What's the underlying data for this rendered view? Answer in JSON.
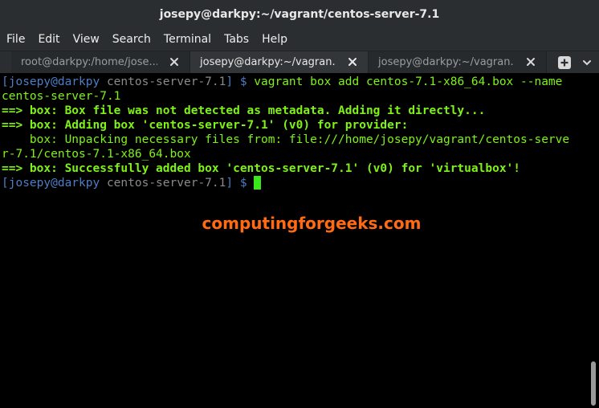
{
  "window": {
    "title": "josepy@darkpy:~/vagrant/centos-server-7.1"
  },
  "menubar": {
    "items": [
      "File",
      "Edit",
      "View",
      "Search",
      "Terminal",
      "Tabs",
      "Help"
    ]
  },
  "tabs": [
    {
      "label": "root@darkpy:/home/jose...",
      "active": false
    },
    {
      "label": "josepy@darkpy:~/vagran...",
      "active": true
    },
    {
      "label": "josepy@darkpy:~/vagran...",
      "active": false
    }
  ],
  "terminal": {
    "lines": [
      {
        "prompt_user": "[josepy@darkpy ",
        "prompt_dir": "centos-server-7.1",
        "prompt_end": "] $ ",
        "command": "vagrant box add centos-7.1-x86_64.box --name"
      },
      {
        "text": "centos-server-7.1"
      },
      {
        "arrow": "==> ",
        "text": "box: Box file was not detected as metadata. Adding it directly..."
      },
      {
        "arrow": "==> ",
        "text": "box: Adding box 'centos-server-7.1' (v0) for provider:"
      },
      {
        "text": "    box: Unpacking necessary files from: file:///home/josepy/vagrant/centos-serve"
      },
      {
        "text": "r-7.1/centos-7.1-x86_64.box"
      },
      {
        "arrow": "==> ",
        "text": "box: Successfully added box 'centos-server-7.1' (v0) for 'virtualbox'!"
      },
      {
        "prompt_user": "[josepy@darkpy ",
        "prompt_dir": "centos-server-7.1",
        "prompt_end": "] $ ",
        "command": ""
      }
    ]
  },
  "watermark": "computingforgeeks.com",
  "colors": {
    "background": "#000000",
    "prompt": "#4c7ec4",
    "output": "#7ef218",
    "watermark": "#ff6a13"
  }
}
